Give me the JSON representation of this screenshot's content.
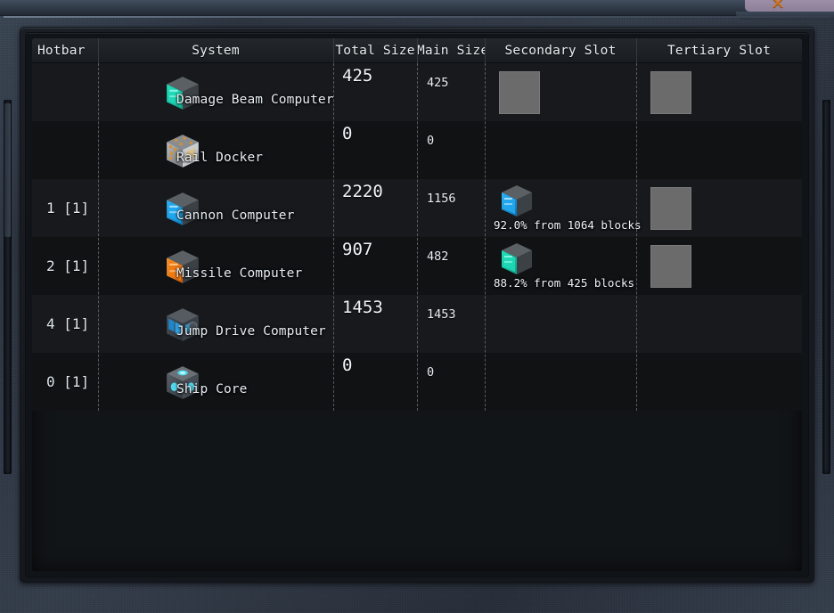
{
  "window": {
    "close_icon": "✕",
    "close_icon_name": "close-icon"
  },
  "table": {
    "columns": [
      {
        "key": "hotbar",
        "label": "Hotbar"
      },
      {
        "key": "system",
        "label": "System"
      },
      {
        "key": "total",
        "label": "Total Size"
      },
      {
        "key": "main",
        "label": "Main Size"
      },
      {
        "key": "secondary",
        "label": "Secondary Slot"
      },
      {
        "key": "tertiary",
        "label": "Tertiary Slot"
      }
    ],
    "rows": [
      {
        "hotbar": "",
        "system": "Damage Beam Computer",
        "system_icon": "damage-beam-computer-icon",
        "total": "425",
        "main": "425",
        "secondary_slot": {
          "type": "placeholder",
          "text": ""
        },
        "tertiary_slot": {
          "type": "placeholder",
          "text": ""
        }
      },
      {
        "hotbar": "",
        "system": "Rail Docker",
        "system_icon": "rail-docker-icon",
        "total": "0",
        "main": "0",
        "secondary_slot": {
          "type": "empty",
          "text": ""
        },
        "tertiary_slot": {
          "type": "empty",
          "text": ""
        }
      },
      {
        "hotbar": "1 [1]",
        "system": "Cannon Computer",
        "system_icon": "cannon-computer-icon",
        "total": "2220",
        "main": "1156",
        "secondary_slot": {
          "type": "icon",
          "icon": "cannon-computer-icon",
          "text": "92.0% from 1064 blocks"
        },
        "tertiary_slot": {
          "type": "placeholder",
          "text": ""
        }
      },
      {
        "hotbar": "2 [1]",
        "system": "Missile Computer",
        "system_icon": "missile-computer-icon",
        "total": "907",
        "main": "482",
        "secondary_slot": {
          "type": "icon",
          "icon": "damage-beam-computer-icon",
          "text": "88.2% from 425 blocks"
        },
        "tertiary_slot": {
          "type": "placeholder",
          "text": ""
        }
      },
      {
        "hotbar": "4 [1]",
        "system": "Jump Drive Computer",
        "system_icon": "jump-drive-computer-icon",
        "total": "1453",
        "main": "1453",
        "secondary_slot": {
          "type": "empty",
          "text": ""
        },
        "tertiary_slot": {
          "type": "empty",
          "text": ""
        }
      },
      {
        "hotbar": "0 [1]",
        "system": "Ship Core",
        "system_icon": "ship-core-icon",
        "total": "0",
        "main": "0",
        "secondary_slot": {
          "type": "empty",
          "text": ""
        },
        "tertiary_slot": {
          "type": "empty",
          "text": ""
        }
      }
    ]
  },
  "colors": {
    "frame": "#2e3744",
    "panel_bg": "#121518",
    "row_odd": "#17191c",
    "row_even": "#101214",
    "header_bg": "#24282c",
    "text": "#e8eef3",
    "slot_placeholder": "#6b6b6b",
    "close_accent": "#d2761e",
    "icon_damage_beam": "#1fd9b8",
    "icon_cannon": "#22a8f0",
    "icon_missile": "#f07a12",
    "icon_rail_docker": "#d89030",
    "icon_jump_drive": "#2f9fe0",
    "icon_ship_core": "#4fd8ef"
  }
}
